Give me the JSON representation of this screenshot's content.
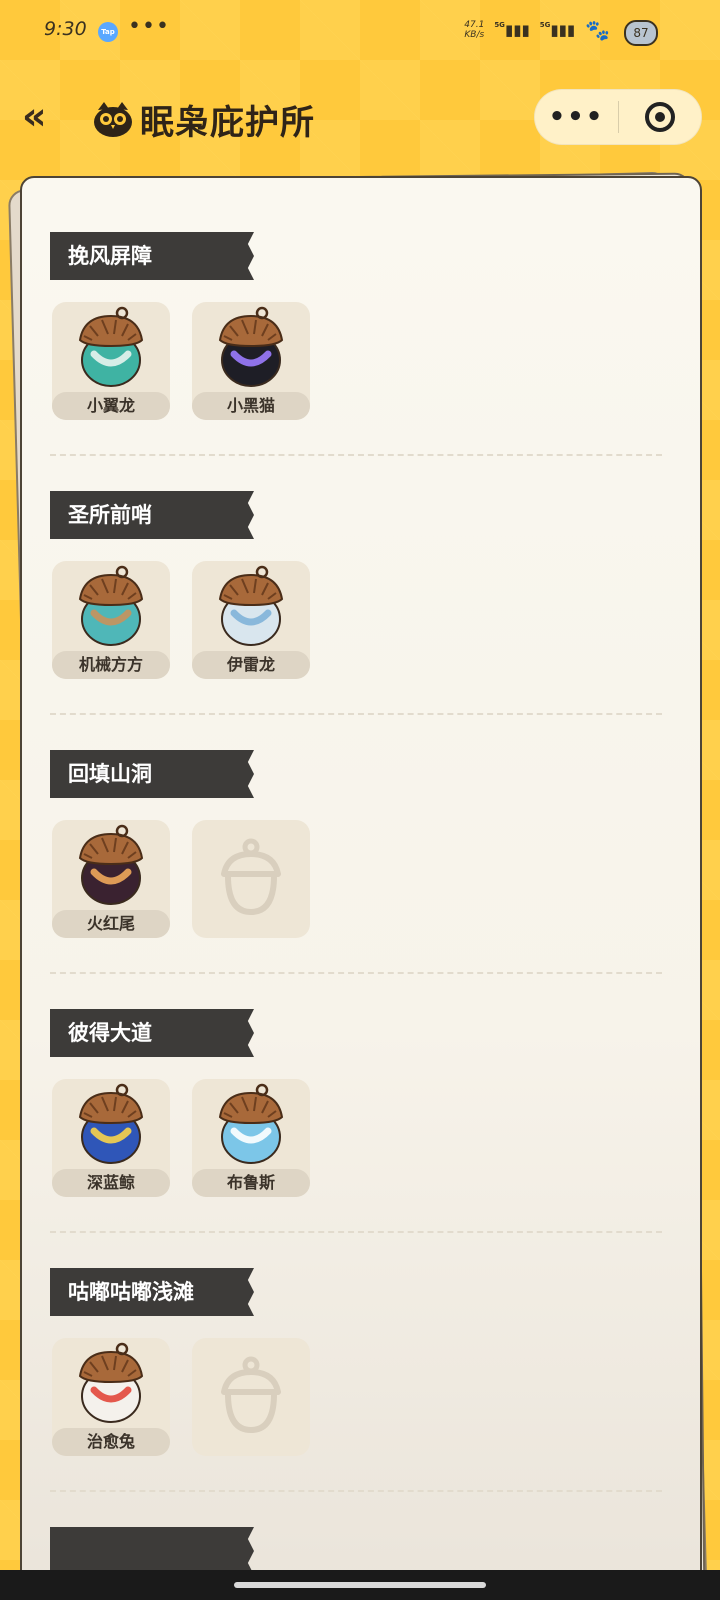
{
  "status_bar": {
    "time": "9:30",
    "tap_badge": "Tap",
    "more_dots": "•••",
    "net_speed_value": "47.1",
    "net_speed_unit": "KB/s",
    "signal_label_1": "5G",
    "signal_label_2": "5G",
    "battery": "87"
  },
  "header": {
    "back_glyph": "«",
    "title": "眠枭庇护所",
    "capsule_more": "•••"
  },
  "sections": [
    {
      "title": "挽风屏障",
      "slots": [
        {
          "name": "小翼龙",
          "filled": true,
          "color": "#3FB3A3",
          "accent": "#E8F3EE"
        },
        {
          "name": "小黑猫",
          "filled": true,
          "color": "#1E1E26",
          "accent": "#9B7BFF"
        }
      ]
    },
    {
      "title": "圣所前哨",
      "slots": [
        {
          "name": "机械方方",
          "filled": true,
          "color": "#4FB7B8",
          "accent": "#C8925C"
        },
        {
          "name": "伊雷龙",
          "filled": true,
          "color": "#D9E6EE",
          "accent": "#7FB2D8"
        }
      ]
    },
    {
      "title": "回填山洞",
      "slots": [
        {
          "name": "火红尾",
          "filled": true,
          "color": "#3A2230",
          "accent": "#F0A95B"
        },
        {
          "name": "",
          "filled": false
        }
      ]
    },
    {
      "title": "彼得大道",
      "slots": [
        {
          "name": "深蓝鲸",
          "filled": true,
          "color": "#2F56B8",
          "accent": "#F8D44A"
        },
        {
          "name": "布鲁斯",
          "filled": true,
          "color": "#7CC6E8",
          "accent": "#ffffff"
        }
      ]
    },
    {
      "title": "咕嘟咕嘟浅滩",
      "slots": [
        {
          "name": "治愈兔",
          "filled": true,
          "color": "#F4F1EC",
          "accent": "#E2473B"
        },
        {
          "name": "",
          "filled": false
        }
      ]
    }
  ]
}
